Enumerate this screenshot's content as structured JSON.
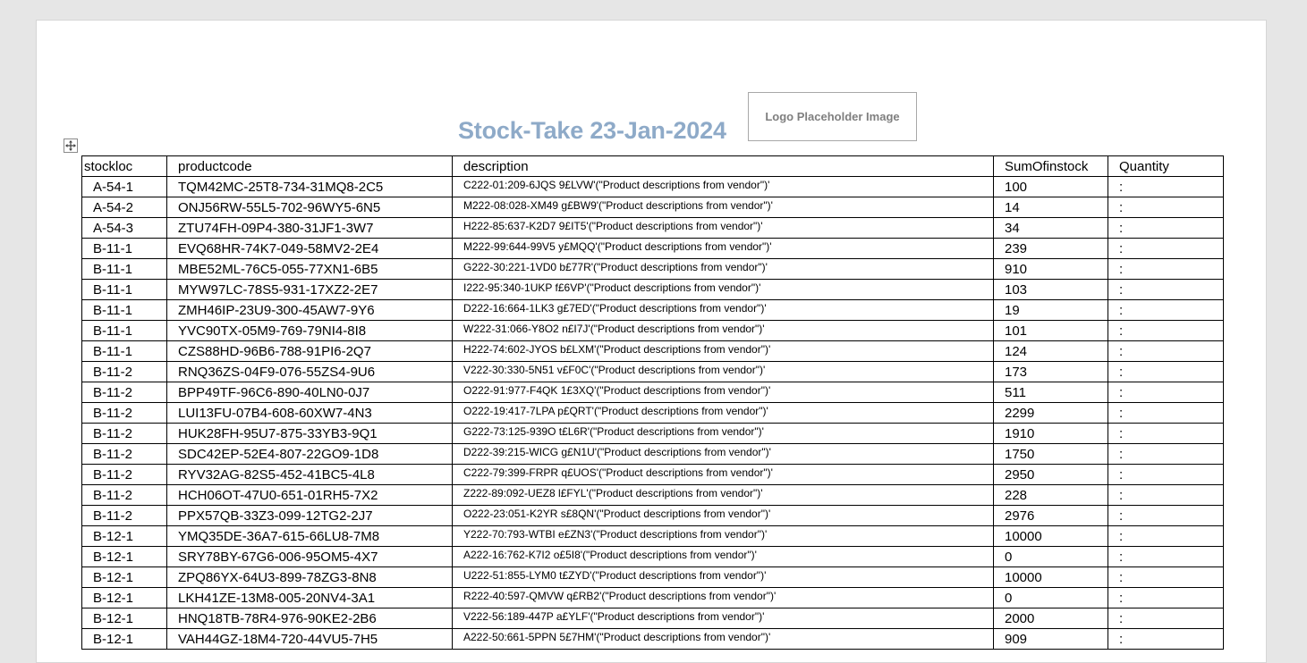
{
  "document": {
    "title": "Stock-Take 23-Jan-2024",
    "logo_text": "Logo Placeholder Image"
  },
  "table": {
    "headers": [
      "stockloc",
      "productcode",
      "description",
      "SumOfinstock",
      "Quantity"
    ],
    "rows": [
      [
        "A-54-1",
        "TQM42MC-25T8-734-31MQ8-2C5",
        "C222-01:209-6JQS 9£LVW'(\"Product descriptions from vendor\")'",
        "100",
        ":"
      ],
      [
        "A-54-2",
        "ONJ56RW-55L5-702-96WY5-6N5",
        "M222-08:028-XM49 g£BW9'(\"Product descriptions from vendor\")'",
        "14",
        ":"
      ],
      [
        "A-54-3",
        "ZTU74FH-09P4-380-31JF1-3W7",
        "H222-85:637-K2D7 9£IT5'(\"Product descriptions from vendor\")'",
        "34",
        ":"
      ],
      [
        "B-11-1",
        "EVQ68HR-74K7-049-58MV2-2E4",
        "M222-99:644-99V5 y£MQQ'(\"Product descriptions from vendor\")'",
        "239",
        ":"
      ],
      [
        "B-11-1",
        "MBE52ML-76C5-055-77XN1-6B5",
        "G222-30:221-1VD0 b£77R'(\"Product descriptions from vendor\")'",
        "910",
        ":"
      ],
      [
        "B-11-1",
        "MYW97LC-78S5-931-17XZ2-2E7",
        "I222-95:340-1UKP f£6VP'(\"Product descriptions from vendor\")'",
        "103",
        ":"
      ],
      [
        "B-11-1",
        "ZMH46IP-23U9-300-45AW7-9Y6",
        "D222-16:664-1LK3 g£7ED'(\"Product descriptions from vendor\")'",
        "19",
        ":"
      ],
      [
        "B-11-1",
        "YVC90TX-05M9-769-79NI4-8I8",
        "W222-31:066-Y8O2 n£I7J'(\"Product descriptions from vendor\")'",
        "101",
        ":"
      ],
      [
        "B-11-1",
        "CZS88HD-96B6-788-91PI6-2Q7",
        "H222-74:602-JYOS b£LXM'(\"Product descriptions from vendor\")'",
        "124",
        ":"
      ],
      [
        "B-11-2",
        "RNQ36ZS-04F9-076-55ZS4-9U6",
        "V222-30:330-5N51 v£F0C'(\"Product descriptions from vendor\")'",
        "173",
        ":"
      ],
      [
        "B-11-2",
        "BPP49TF-96C6-890-40LN0-0J7",
        "O222-91:977-F4QK 1£3XQ'(\"Product descriptions from vendor\")'",
        "511",
        ":"
      ],
      [
        "B-11-2",
        "LUI13FU-07B4-608-60XW7-4N3",
        "O222-19:417-7LPA p£QRT'(\"Product descriptions from vendor\")'",
        "2299",
        ":"
      ],
      [
        "B-11-2",
        "HUK28FH-95U7-875-33YB3-9Q1",
        "G222-73:125-939O t£L6R'(\"Product descriptions from vendor\")'",
        "1910",
        ":"
      ],
      [
        "B-11-2",
        "SDC42EP-52E4-807-22GO9-1D8",
        "D222-39:215-WICG g£N1U'(\"Product descriptions from vendor\")'",
        "1750",
        ":"
      ],
      [
        "B-11-2",
        "RYV32AG-82S5-452-41BC5-4L8",
        "C222-79:399-FRPR q£UOS'(\"Product descriptions from vendor\")'",
        "2950",
        ":"
      ],
      [
        "B-11-2",
        "HCH06OT-47U0-651-01RH5-7X2",
        "Z222-89:092-UEZ8 l£FYL'(\"Product descriptions from vendor\")'",
        "228",
        ":"
      ],
      [
        "B-11-2",
        "PPX57QB-33Z3-099-12TG2-2J7",
        "O222-23:051-K2YR s£8QN'(\"Product descriptions from vendor\")'",
        "2976",
        ":"
      ],
      [
        "B-12-1",
        "YMQ35DE-36A7-615-66LU8-7M8",
        "Y222-70:793-WTBI e£ZN3'(\"Product descriptions from vendor\")'",
        "10000",
        ":"
      ],
      [
        "B-12-1",
        "SRY78BY-67G6-006-95OM5-4X7",
        "A222-16:762-K7I2 o£5I8'(\"Product descriptions from vendor\")'",
        "0",
        ":"
      ],
      [
        "B-12-1",
        "ZPQ86YX-64U3-899-78ZG3-8N8",
        "U222-51:855-LYM0 t£ZYD'(\"Product descriptions from vendor\")'",
        "10000",
        ":"
      ],
      [
        "B-12-1",
        "LKH41ZE-13M8-005-20NV4-3A1",
        "R222-40:597-QMVW q£RB2'(\"Product descriptions from vendor\")'",
        "0",
        ":"
      ],
      [
        "B-12-1",
        "HNQ18TB-78R4-976-90KE2-2B6",
        "V222-56:189-447P a£YLF'(\"Product descriptions from vendor\")'",
        "2000",
        ":"
      ],
      [
        "B-12-1",
        "VAH44GZ-18M4-720-44VU5-7H5",
        "A222-50:661-5PPN 5£7HM'(\"Product descriptions from vendor\")'",
        "909",
        ":"
      ]
    ]
  }
}
